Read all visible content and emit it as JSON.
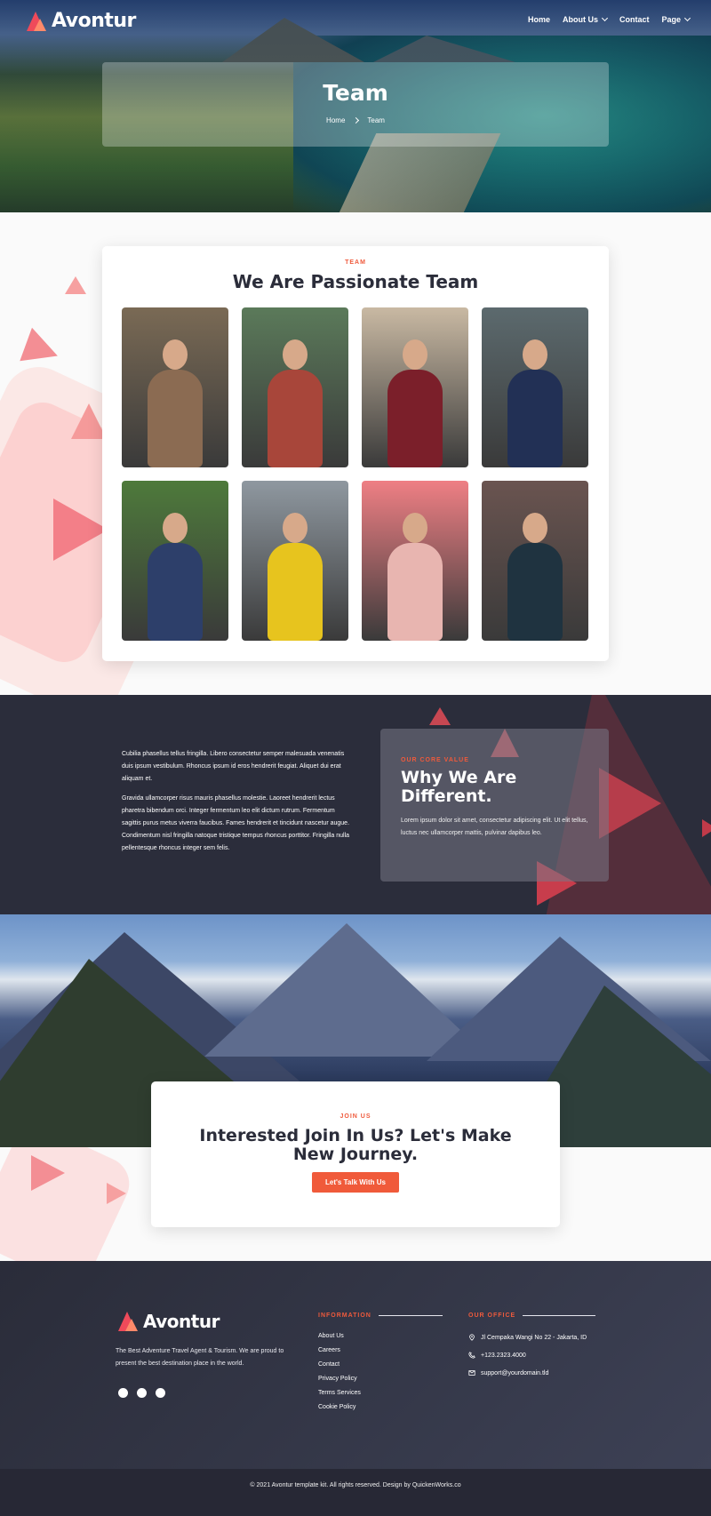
{
  "brand": {
    "name": "Avontur"
  },
  "nav": {
    "home": "Home",
    "about": "About Us",
    "contact": "Contact",
    "page": "Page"
  },
  "hero": {
    "title": "Team",
    "breadcrumb_home": "Home",
    "breadcrumb_current": "Team"
  },
  "team": {
    "eyebrow": "TEAM",
    "title": "We Are Passionate Team",
    "members": [
      {
        "bg": "#7a6a55",
        "coat": "#8b6b52"
      },
      {
        "bg": "#5b7a5a",
        "coat": "#a8463a"
      },
      {
        "bg": "#c9b9a3",
        "coat": "#7b1f2a"
      },
      {
        "bg": "#5c6a6e",
        "coat": "#223055"
      },
      {
        "bg": "#4e7a3b",
        "coat": "#2d3f6a"
      },
      {
        "bg": "#8f98a0",
        "coat": "#e7c41e"
      },
      {
        "bg": "#ef7f84",
        "coat": "#e8b5b0"
      },
      {
        "bg": "#6a5450",
        "coat": "#1f3340"
      }
    ]
  },
  "value": {
    "paragraph_1": "Cubilia phasellus tellus fringilla. Libero consectetur semper malesuada venenatis duis ipsum vestibulum. Rhoncus ipsum id eros hendrerit feugiat. Aliquet dui erat aliquam et.",
    "paragraph_2": "Gravida ullamcorper risus mauris phasellus molestie. Laoreet hendrerit lectus pharetra bibendum orci. Integer fermentum leo elit dictum rutrum. Fermentum sagittis purus metus viverra faucibus. Fames hendrerit et tincidunt nascetur augue. Condimentum nisl fringilla natoque tristique tempus rhoncus porttitor. Fringilla nulla pellentesque rhoncus integer sem felis.",
    "eyebrow": "OUR CORE VALUE",
    "title": "Why We Are Different.",
    "description": "Lorem ipsum dolor sit amet, consectetur adipiscing elit. Ut elit tellus, luctus nec ullamcorper mattis, pulvinar dapibus leo."
  },
  "join": {
    "eyebrow": "JOIN US",
    "title": "Interested Join In Us? Let's Make New Journey.",
    "button": "Let's Talk With Us"
  },
  "footer": {
    "description": "The Best Adventure Travel Agent & Tourism. We are proud to present the best destination place in the world.",
    "socials": [
      "facebook-icon",
      "twitter-icon",
      "youtube-icon"
    ],
    "information_title": "INFORMATION",
    "links": [
      "About Us",
      "Careers",
      "Contact",
      "Privacy Policy",
      "Terms Services",
      "Cookie Policy"
    ],
    "office_title": "OUR OFFICE",
    "address": "Jl Cempaka Wangi No 22 - Jakarta, ID",
    "phone": "+123.2323.4000",
    "email": "support@yourdomain.tld",
    "copyright": "© 2021 Avontur template kit. All rights reserved. Design by QuickenWorks.co"
  },
  "colors": {
    "accent": "#f05a3a",
    "brand_red": "#ef4a5a",
    "dark": "#2b2d3b"
  }
}
